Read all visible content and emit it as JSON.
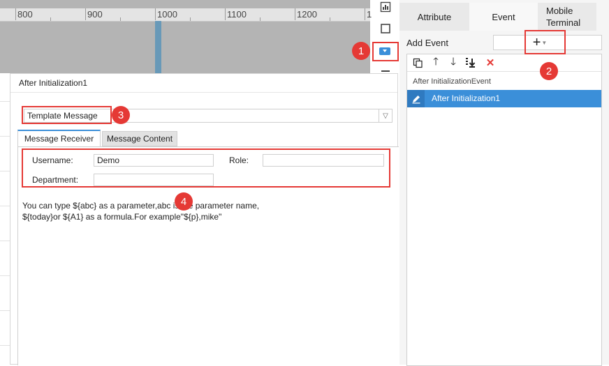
{
  "ruler": {
    "labels": [
      "800",
      "900",
      "1000",
      "1100",
      "1200",
      "1"
    ]
  },
  "right_panel": {
    "tabs": [
      {
        "label": "Attribute"
      },
      {
        "label": "Event"
      },
      {
        "label": "Mobile Terminal"
      }
    ],
    "add_event_label": "Add Event",
    "add_button_glyph": "+",
    "event_group_label": "After InitializationEvent",
    "event_item_label": "After Initialization1",
    "toolbar_icons": [
      "copy-icon",
      "arrow-up-icon",
      "arrow-down-icon",
      "move-bottom-icon",
      "delete-icon"
    ]
  },
  "dialog": {
    "title": "After Initialization1",
    "template_select": {
      "value": "Template Message"
    },
    "tabs": [
      {
        "label": "Message Receiver",
        "active": true
      },
      {
        "label": "Message Content",
        "active": false
      }
    ],
    "fields": {
      "username_label": "Username:",
      "username_value": "Demo",
      "role_label": "Role:",
      "role_value": "",
      "department_label": "Department:",
      "department_value": ""
    },
    "help_text": "You can type ${abc} as a parameter,abc is the parameter name,\n${today}or ${A1} as a formula.For example\"${p},mike\""
  },
  "annotations": [
    "1",
    "2",
    "3",
    "4"
  ],
  "colors": {
    "accent": "#3b8fd9",
    "annotation": "#e53935",
    "delete": "#e53935"
  }
}
